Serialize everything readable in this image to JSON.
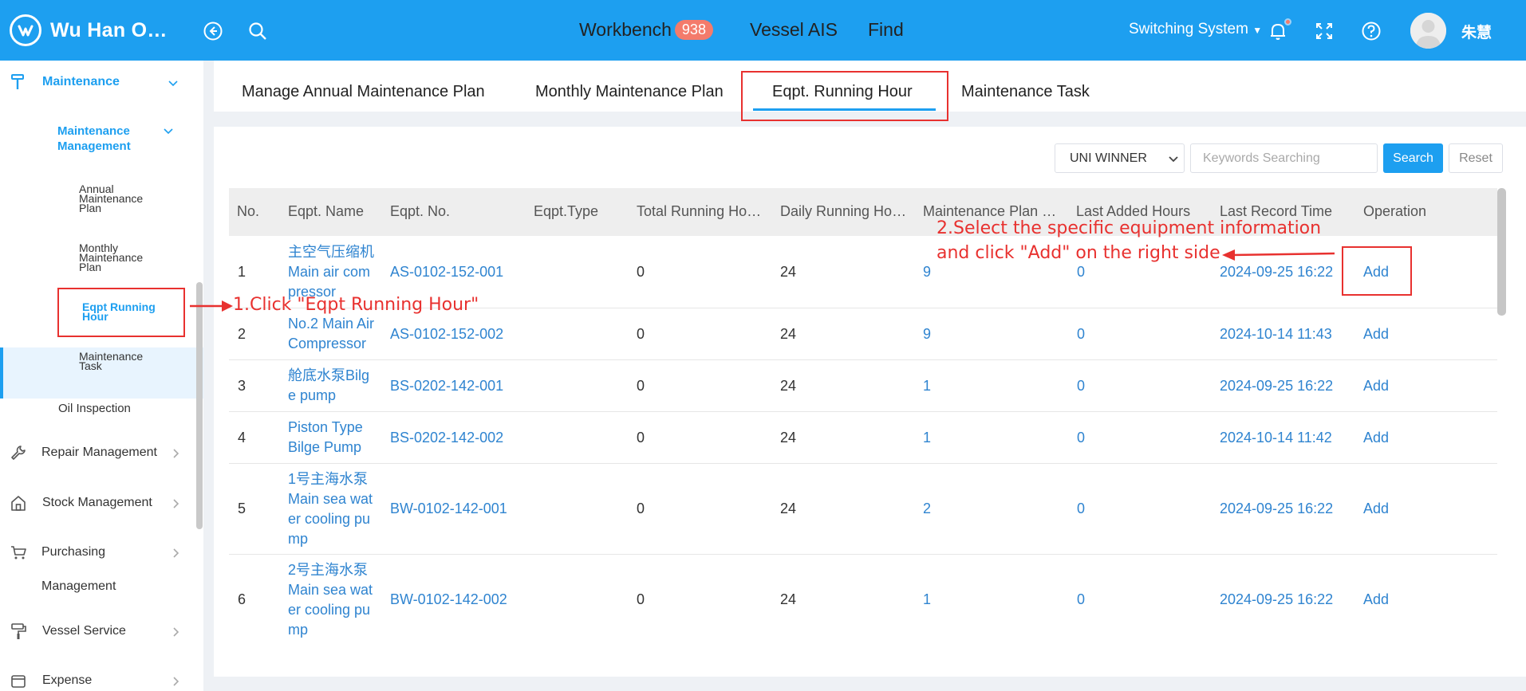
{
  "header": {
    "app_title": "Wu Han O…",
    "nav": [
      {
        "label": "Workbench",
        "badge": "938"
      },
      {
        "label": "Vessel AIS"
      },
      {
        "label": "Find"
      }
    ],
    "switch_system": "Switching System",
    "username": "朱慧"
  },
  "sidebar": {
    "maintenance": "Maintenance",
    "maintenance_management": [
      "Maintenance",
      "Management"
    ],
    "sub_items": [
      {
        "label": [
          "Annual",
          "Maintenance",
          "Plan"
        ]
      },
      {
        "label": [
          "Monthly",
          "Maintenance",
          "Plan"
        ]
      },
      {
        "label": [
          "Eqpt Running",
          "Hour"
        ]
      },
      {
        "label": [
          "Maintenance",
          "Task"
        ]
      }
    ],
    "oil_inspection": "Oil Inspection",
    "repair_management": "Repair Management",
    "stock_management": "Stock Management",
    "purchasing": "Purchasing",
    "purchasing_line2": "Management",
    "vessel_service": "Vessel Service",
    "expense": "Expense"
  },
  "tabs": [
    "Manage Annual Maintenance Plan",
    "Monthly Maintenance Plan",
    "Eqpt. Running Hour",
    "Maintenance Task"
  ],
  "filters": {
    "vessel_select": "UNI WINNER",
    "search_placeholder": "Keywords Searching",
    "search_button": "Search",
    "reset_button": "Reset"
  },
  "table": {
    "headers": [
      "No.",
      "Eqpt. Name",
      "Eqpt. No.",
      "Eqpt.Type",
      "Total Running Ho…",
      "Daily Running Ho…",
      "Maintenance Plan …",
      "Last Added Hours",
      "Last Record Time",
      "Operation"
    ],
    "rows": [
      {
        "no": "1",
        "name": [
          "主空气压缩机",
          "Main air com",
          "pressor"
        ],
        "eqpt_no": "AS-0102-152-001",
        "type": "",
        "total": "0",
        "daily": "24",
        "plan": "9",
        "last_added": "0",
        "last_time": "2024-09-25 16:22",
        "op": "Add"
      },
      {
        "no": "2",
        "name": [
          "No.2 Main Air",
          "Compressor"
        ],
        "eqpt_no": "AS-0102-152-002",
        "type": "",
        "total": "0",
        "daily": "24",
        "plan": "9",
        "last_added": "0",
        "last_time": "2024-10-14 11:43",
        "op": "Add"
      },
      {
        "no": "3",
        "name": [
          "舱底水泵Bilg",
          "e pump"
        ],
        "eqpt_no": "BS-0202-142-001",
        "type": "",
        "total": "0",
        "daily": "24",
        "plan": "1",
        "last_added": "0",
        "last_time": "2024-09-25 16:22",
        "op": "Add"
      },
      {
        "no": "4",
        "name": [
          "Piston Type",
          "Bilge Pump"
        ],
        "eqpt_no": "BS-0202-142-002",
        "type": "",
        "total": "0",
        "daily": "24",
        "plan": "1",
        "last_added": "0",
        "last_time": "2024-10-14 11:42",
        "op": "Add"
      },
      {
        "no": "5",
        "name": [
          "1号主海水泵",
          "Main sea wat",
          "er cooling pu",
          "mp"
        ],
        "eqpt_no": "BW-0102-142-001",
        "type": "",
        "total": "0",
        "daily": "24",
        "plan": "2",
        "last_added": "0",
        "last_time": "2024-09-25 16:22",
        "op": "Add"
      },
      {
        "no": "6",
        "name": [
          "2号主海水泵",
          "Main sea wat",
          "er cooling pu",
          "mp"
        ],
        "eqpt_no": "BW-0102-142-002",
        "type": "",
        "total": "0",
        "daily": "24",
        "plan": "1",
        "last_added": "0",
        "last_time": "2024-09-25 16:22",
        "op": "Add"
      }
    ]
  },
  "annotations": {
    "step1": "1.Click \"Eqpt Running Hour\"",
    "step2_line1": "2.Select the specific equipment information",
    "step2_line2": "and click \"Add\" on the right side"
  }
}
